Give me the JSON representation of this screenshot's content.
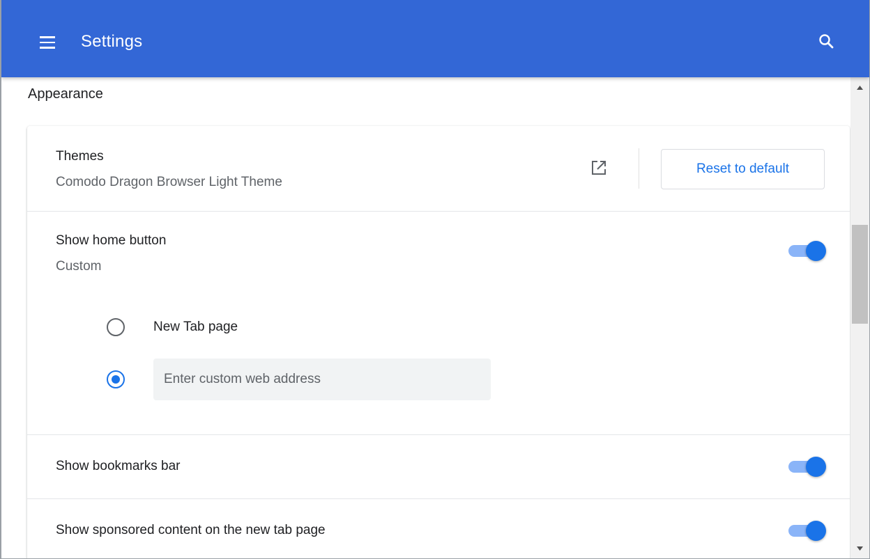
{
  "appbar": {
    "title": "Settings",
    "menu_icon": "hamburger-menu-icon",
    "search_icon": "search-icon",
    "color": "#3367d6"
  },
  "section": {
    "title": "Appearance"
  },
  "themes": {
    "label": "Themes",
    "value": "Comodo Dragon Browser Light Theme",
    "external_icon": "open-in-new-icon",
    "reset_label": "Reset to default"
  },
  "home_button": {
    "label": "Show home button",
    "sublabel": "Custom",
    "enabled": true,
    "options": [
      {
        "label": "New Tab page",
        "checked": false
      },
      {
        "label": "",
        "checked": true
      }
    ],
    "custom_placeholder": "Enter custom web address"
  },
  "bookmarks_bar": {
    "label": "Show bookmarks bar",
    "enabled": true
  },
  "sponsored": {
    "label": "Show sponsored content on the new tab page",
    "enabled": true
  },
  "accent": "#1a73e8"
}
